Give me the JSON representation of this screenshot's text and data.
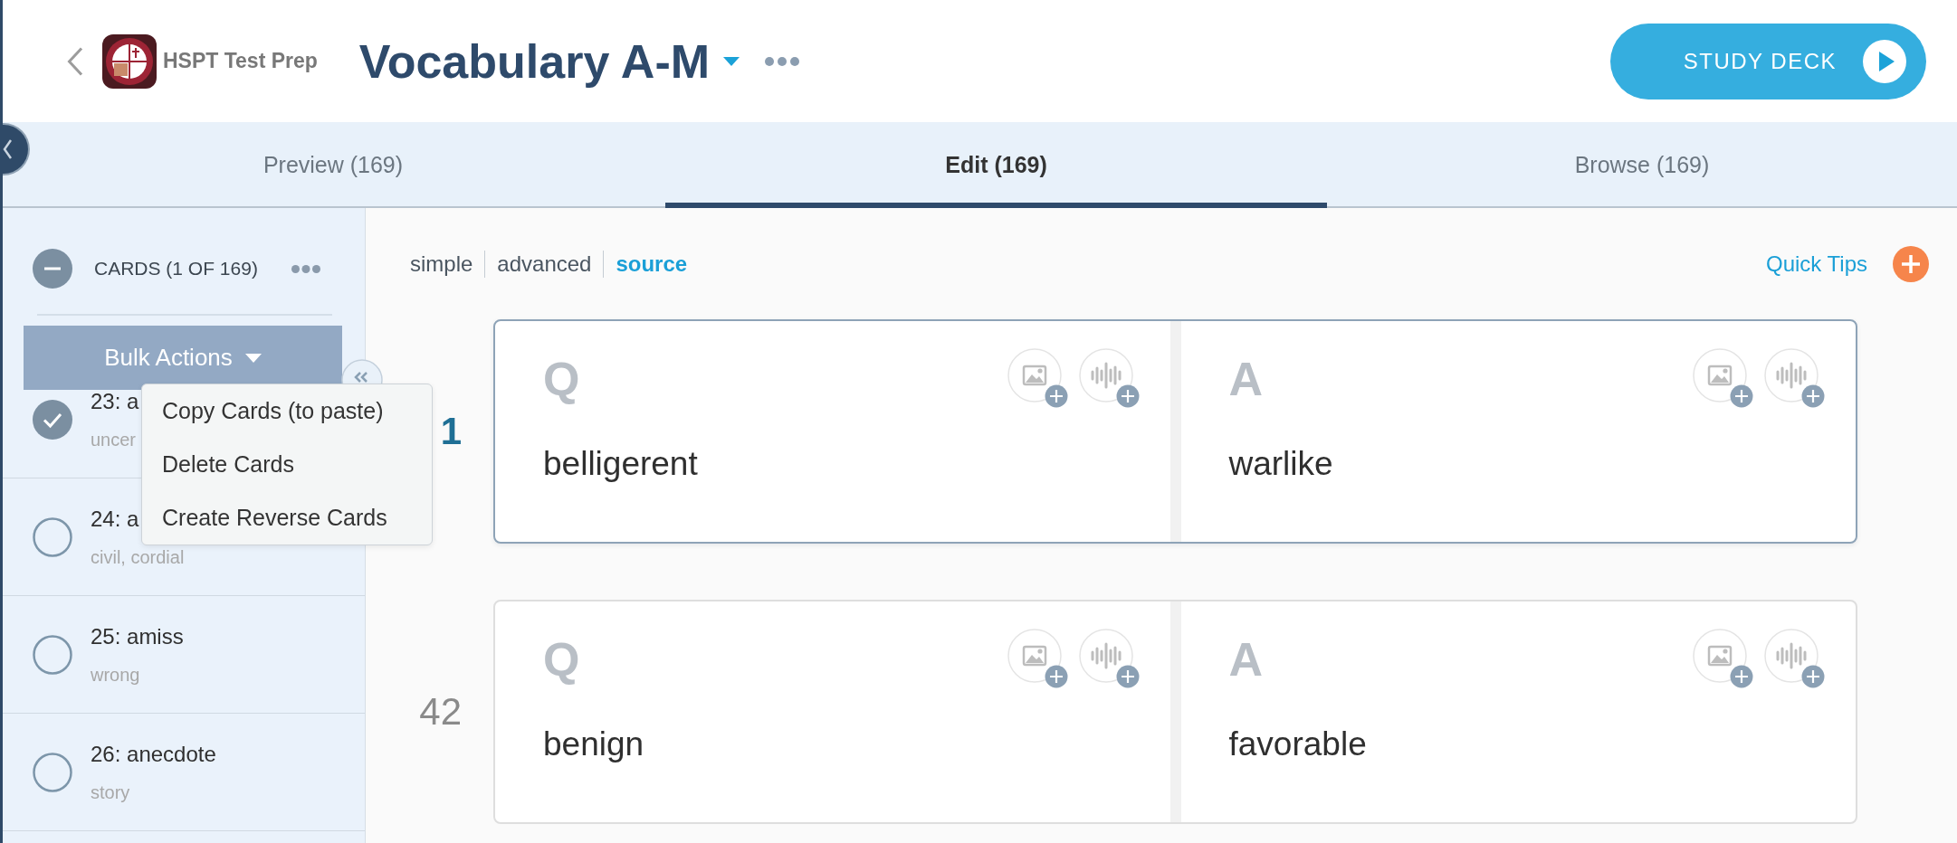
{
  "header": {
    "group_name": "HSPT Test Prep",
    "title": "Vocabulary A-M",
    "study_button": "STUDY DECK"
  },
  "tabs": [
    {
      "label": "Preview (169)",
      "selected": false
    },
    {
      "label": "Edit (169)",
      "selected": true
    },
    {
      "label": "Browse (169)",
      "selected": false
    }
  ],
  "sidebar": {
    "title": "CARDS (1 OF 169)",
    "bulk_actions": {
      "label": "Bulk Actions",
      "expanded": true,
      "menu": [
        "Copy Cards (to paste)",
        "Delete Cards",
        "Create Reverse Cards"
      ]
    },
    "cards": [
      {
        "title": "23: a",
        "subtitle": "uncer",
        "checked": true
      },
      {
        "title": "24: a",
        "subtitle": "civil, cordial",
        "checked": false
      },
      {
        "title": "25: amiss",
        "subtitle": "wrong",
        "checked": false
      },
      {
        "title": "26: anecdote",
        "subtitle": "story",
        "checked": false
      }
    ]
  },
  "editor": {
    "modes": [
      {
        "label": "simple",
        "selected": false
      },
      {
        "label": "advanced",
        "selected": false
      },
      {
        "label": "source",
        "selected": true
      }
    ],
    "quick_tips": "Quick Tips",
    "cards": [
      {
        "number": "1",
        "selected": true,
        "sides": [
          {
            "label": "Q",
            "text": "belligerent"
          },
          {
            "label": "A",
            "text": "warlike"
          }
        ]
      },
      {
        "number": "42",
        "selected": false,
        "sides": [
          {
            "label": "Q",
            "text": "benign"
          },
          {
            "label": "A",
            "text": "favorable"
          }
        ]
      }
    ]
  }
}
